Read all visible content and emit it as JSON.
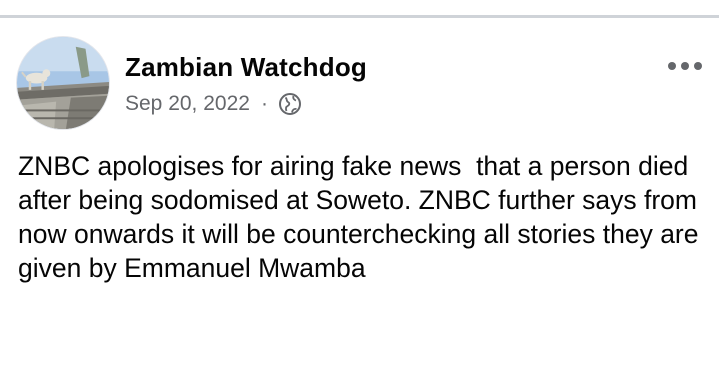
{
  "post": {
    "author": "Zambian Watchdog",
    "date": "Sep 20, 2022",
    "separator": "·",
    "audience_icon": "globe-icon",
    "menu_icon": "more-options-icon",
    "text": "ZNBC apologises for airing fake news  that a person died after being sodomised at Soweto. ZNBC further says from now onwards it will be counterchecking all stories they are given by Emmanuel Mwamba"
  },
  "colors": {
    "name": "#050505",
    "meta": "#65676b",
    "divider": "#cfd3d8"
  }
}
